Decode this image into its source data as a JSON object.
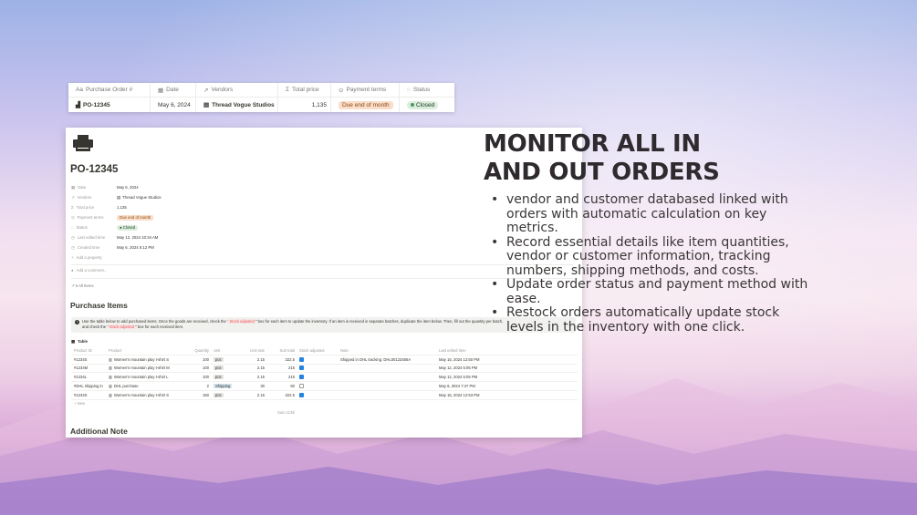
{
  "colors": {
    "green_status": "#dbeddb",
    "orange_terms": "#fadec9",
    "checkbox_blue": "#2383e2"
  },
  "strip": {
    "headers": [
      "Purchase Order #",
      "Date",
      "Vendors",
      "Total price",
      "Payment terms",
      "Status"
    ],
    "row": {
      "po": "PO-12345",
      "date": "May 6, 2024",
      "vendor": "Thread Vogue Studios",
      "total": "1,135",
      "terms": "Due end of month",
      "status": "Closed"
    }
  },
  "page": {
    "title": "PO-12345",
    "properties": [
      {
        "label": "Date",
        "value": "May 6, 2024"
      },
      {
        "label": "Vendors",
        "value": "Thread Vogue Studios"
      },
      {
        "label": "Total price",
        "value": "1,135"
      },
      {
        "label": "Payment terms",
        "value": "Due end of month"
      },
      {
        "label": "Status",
        "value": "Closed"
      },
      {
        "label": "Last edited time",
        "value": "May 12, 2024 10:34 AM"
      },
      {
        "label": "Created time",
        "value": "May 6, 2024 6:12 PM"
      }
    ],
    "add_property": "Add a property",
    "add_comment": "Add a comment...",
    "backlinks": "5 All Items",
    "section_purchase": "Purchase Items",
    "callout_1": "Use the table below to add purchased items. Once the goods are received, check the \"",
    "callout_code": "Stock adjusted",
    "callout_2": "\" box for each item to update the inventory. If an item is received in separate batches, duplicate the item below. Then, fill out the quantity per batch,",
    "callout_3": "and check the \"",
    "callout_4": "\" box for each received item.",
    "table_label": "Table",
    "columns": [
      "Product ID",
      "Product",
      "Quantity",
      "Unit",
      "Unit rate",
      "Sub total",
      "Stock adjusted",
      "Note",
      "Last edited time"
    ],
    "rows": [
      {
        "id": "#1234S",
        "product": "Women's mountain play t-shirt S",
        "qty": "100",
        "unit": "pcs",
        "rate": "2.15",
        "sub": "322.5",
        "adjusted": true,
        "note": "Shipped in DHL tracking: DHL00123456A",
        "edited": "May 15, 2024 12:50 PM"
      },
      {
        "id": "#1234M",
        "product": "Women's mountain play t-shirt M",
        "qty": "100",
        "unit": "pcs",
        "rate": "2.15",
        "sub": "215",
        "adjusted": true,
        "note": "",
        "edited": "May 12, 2024 5:05 PM"
      },
      {
        "id": "#1234L",
        "product": "Women's mountain play t-shirt L",
        "qty": "100",
        "unit": "pcs",
        "rate": "2.15",
        "sub": "215",
        "adjusted": true,
        "note": "",
        "edited": "May 12, 2024 5:05 PM"
      },
      {
        "id": "#DHL shipping in",
        "product": "DHL purchase",
        "qty": "2",
        "unit": "Shipping",
        "rate": "30",
        "sub": "60",
        "adjusted": false,
        "note": "",
        "edited": "May 6, 2024 7:47 PM"
      },
      {
        "id": "#1234S",
        "product": "Women's mountain play t-shirt S",
        "qty": "150",
        "unit": "pcs",
        "rate": "2.15",
        "sub": "322.5",
        "adjusted": true,
        "note": "",
        "edited": "May 15, 2024 12:53 PM"
      }
    ],
    "new_row": "+ New",
    "sum": "Sum 1135",
    "section_note": "Additional Note"
  },
  "heading": "MONITOR ALL IN AND OUT ORDERS",
  "bullets": [
    "vendor and customer databased linked with orders with automatic calculation on key metrics.",
    "Record essential details like item quantities, vendor or customer information, tracking numbers, shipping methods, and costs.",
    "Update order status and payment method with ease.",
    "Restock orders automatically update stock levels in the inventory with one click."
  ]
}
